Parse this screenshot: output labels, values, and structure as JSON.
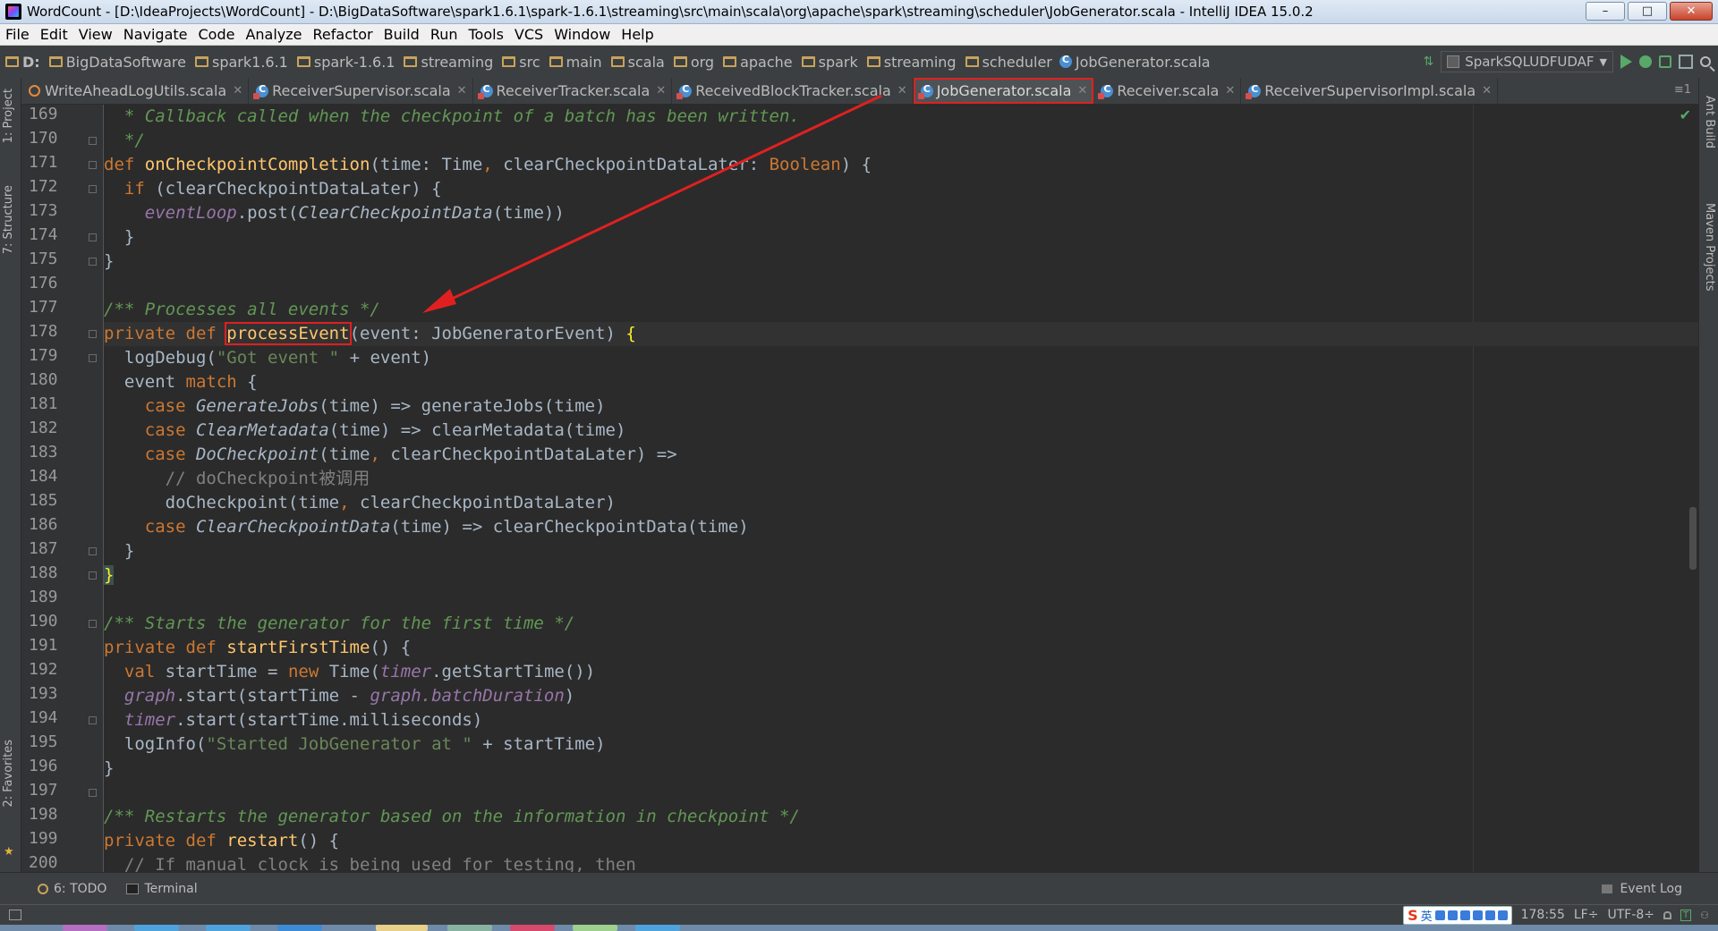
{
  "window": {
    "title": "WordCount - [D:\\IdeaProjects\\WordCount] - D:\\BigDataSoftware\\spark1.6.1\\spark-1.6.1\\streaming\\src\\main\\scala\\org\\apache\\spark\\streaming\\scheduler\\JobGenerator.scala - IntelliJ IDEA 15.0.2",
    "buttons": {
      "minimize": "–",
      "maximize": "□",
      "close": "✕"
    }
  },
  "menu": [
    "File",
    "Edit",
    "View",
    "Navigate",
    "Code",
    "Analyze",
    "Refactor",
    "Build",
    "Run",
    "Tools",
    "VCS",
    "Window",
    "Help"
  ],
  "breadcrumbs": [
    "D:",
    "BigDataSoftware",
    "spark1.6.1",
    "spark-1.6.1",
    "streaming",
    "src",
    "main",
    "scala",
    "org",
    "apache",
    "spark",
    "streaming",
    "scheduler",
    "JobGenerator.scala"
  ],
  "run_config": "SparkSQLUDFUDAF",
  "tabs": [
    {
      "label": "WriteAheadLogUtils.scala",
      "icon": "object-icon"
    },
    {
      "label": "ReceiverSupervisor.scala",
      "icon": "scala-class-icon"
    },
    {
      "label": "ReceiverTracker.scala",
      "icon": "scala-class-icon"
    },
    {
      "label": "ReceivedBlockTracker.scala",
      "icon": "scala-class-icon"
    },
    {
      "label": "JobGenerator.scala",
      "icon": "scala-class-icon",
      "active": true
    },
    {
      "label": "Receiver.scala",
      "icon": "scala-class-icon"
    },
    {
      "label": "ReceiverSupervisorImpl.scala",
      "icon": "scala-class-icon"
    }
  ],
  "tab_overflow": "≡1",
  "left_tools": [
    "1: Project",
    "7: Structure",
    "2: Favorites"
  ],
  "right_tools": [
    "Ant Build",
    "Maven Projects"
  ],
  "line_numbers": [
    "169",
    "170",
    "171",
    "172",
    "173",
    "174",
    "175",
    "176",
    "177",
    "178",
    "179",
    "180",
    "181",
    "182",
    "183",
    "184",
    "185",
    "186",
    "187",
    "188",
    "189",
    "190",
    "191",
    "192",
    "193",
    "194",
    "195",
    "196",
    "197",
    "198",
    "199",
    "200"
  ],
  "code_text": {
    "l169": "* Callback called when the checkpoint of a batch has been written.",
    "l170": "*/",
    "l171_def": "def",
    "l171_name": "onCheckpointCompletion",
    "l171_p1": "(time: Time",
    "l171_c": ",",
    "l171_p2": " clearCheckpointDataLater: ",
    "l171_type": "Boolean",
    "l171_end": ") {",
    "l172_if": "if",
    "l172_rest": " (clearCheckpointDataLater) {",
    "l173_loop": "eventLoop",
    "l173_post": ".post(",
    "l173_cls": "ClearCheckpointData",
    "l173_end": "(time))",
    "l174": "}",
    "l175": "}",
    "l177": "/** Processes all events */",
    "l178_kw": "private def ",
    "l178_name": "processEvent",
    "l178_sig": "(event: JobGeneratorEvent) ",
    "l178_brace": "{",
    "l179_fn": "logDebug(",
    "l179_str": "\"Got event \"",
    "l179_end": " + event)",
    "l180_a": "event ",
    "l180_kw": "match",
    "l180_b": " {",
    "l181_case": "case ",
    "l181_cls": "GenerateJobs",
    "l181_rest": "(time) => generateJobs(time)",
    "l182_case": "case ",
    "l182_cls": "ClearMetadata",
    "l182_rest": "(time) => clearMetadata(time)",
    "l183_case": "case ",
    "l183_cls": "DoCheckpoint",
    "l183_a": "(time",
    "l183_c": ",",
    "l183_b": " clearCheckpointDataLater) =>",
    "l184": "// doCheckpoint被调用",
    "l185_a": "doCheckpoint(time",
    "l185_c": ",",
    "l185_b": " clearCheckpointDataLater)",
    "l186_case": "case ",
    "l186_cls": "ClearCheckpointData",
    "l186_rest": "(time) => clearCheckpointData(time)",
    "l187": "}",
    "l188": "}",
    "l190": "/** Starts the generator for the first time */",
    "l191_kw": "private def ",
    "l191_name": "startFirstTime",
    "l191_end": "() {",
    "l192_val": "val ",
    "l192_a": "startTime = ",
    "l192_new": "new ",
    "l192_b": "Time(",
    "l192_timer": "timer",
    "l192_end": ".getStartTime())",
    "l193_graph": "graph",
    "l193_a": ".start(startTime - ",
    "l193_graph2": "graph",
    "l193_dur": ".batchDuration",
    "l193_end": ")",
    "l194_timer": "timer",
    "l194_rest": ".start(startTime.milliseconds)",
    "l195_fn": "logInfo(",
    "l195_str": "\"Started JobGenerator at \"",
    "l195_end": " + startTime)",
    "l196": "}",
    "l198": "/** Restarts the generator based on the information in checkpoint */",
    "l199_kw": "private def ",
    "l199_name": "restart",
    "l199_end": "() {",
    "l200": "// If manual clock is being used for testing, then"
  },
  "bottom_tabs": {
    "todo": "6: TODO",
    "terminal": "Terminal",
    "event_log": "Event Log"
  },
  "status": {
    "ime_text": "英",
    "position": "178:55",
    "line_sep": "LF÷",
    "encoding": "UTF-8÷"
  },
  "colors": {
    "keyword": "#cc7832",
    "function": "#ffc66d",
    "comment": "#629755",
    "string": "#6a8759",
    "field": "#9876aa",
    "annotation_red": "#e02020"
  }
}
